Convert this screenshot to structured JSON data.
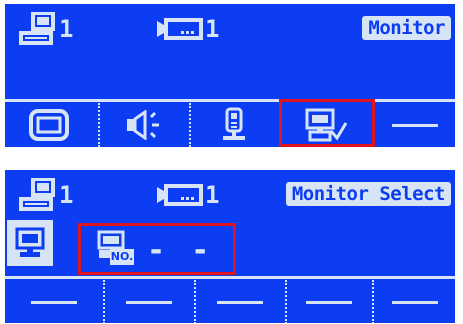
{
  "top_screen": {
    "status": {
      "pc_count": "1",
      "camera_count": "1",
      "title": "Monitor"
    },
    "menu_icons": [
      "monitor-icon",
      "speaker-icon",
      "door-station-icon",
      "monitor-select-icon"
    ],
    "selected_icon": "monitor-select-icon"
  },
  "bottom_screen": {
    "status": {
      "pc_count": "1",
      "camera_count": "1",
      "title": "Monitor Select"
    },
    "monitor_no_label": "NO.",
    "monitor_no_value": "- -"
  },
  "colors": {
    "screen_bg": "#0c3df2",
    "foreground": "#d6e4f5",
    "highlight": "#e0141e"
  }
}
